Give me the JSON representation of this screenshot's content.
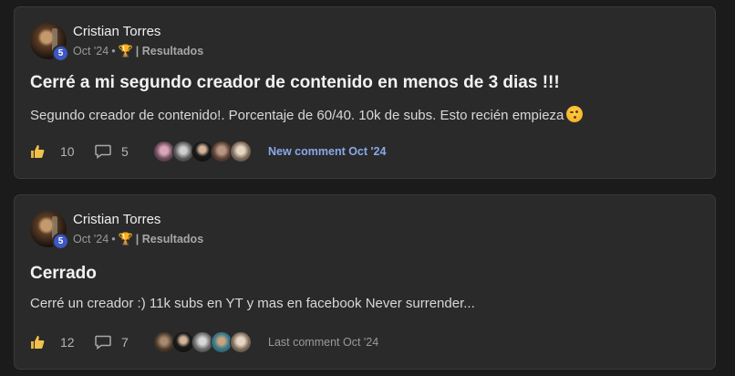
{
  "posts": [
    {
      "author": "Cristian Torres",
      "level": "5",
      "date": "Oct '24",
      "separator": "•",
      "category": "| Resultados",
      "title": "Cerré a mi segundo creador de contenido en menos de 3 dias !!!",
      "body": "Segundo creador de contenido!. Porcentaje de 60/40. 10k de subs. Esto recién empieza",
      "likes": "10",
      "comments": "5",
      "last_comment": "New comment Oct '24"
    },
    {
      "author": "Cristian Torres",
      "level": "5",
      "date": "Oct '24",
      "separator": "•",
      "category": "| Resultados",
      "title": "Cerrado",
      "body": "Cerré un creador :) 11k subs en YT y mas en facebook Never surrender...",
      "likes": "12",
      "comments": "7",
      "last_comment": "Last comment Oct '24"
    }
  ],
  "colors": {
    "background": "#1b1b1b",
    "card": "#2a2a2a",
    "level_badge": "#3c58c2",
    "new_comment": "#8aa8e8",
    "trophy": "#e0a82e"
  },
  "icons": {
    "like": "thumbs-up-icon",
    "comment": "comment-bubble-icon",
    "trophy": "trophy-icon",
    "emoji": "winking-face-emoji"
  }
}
